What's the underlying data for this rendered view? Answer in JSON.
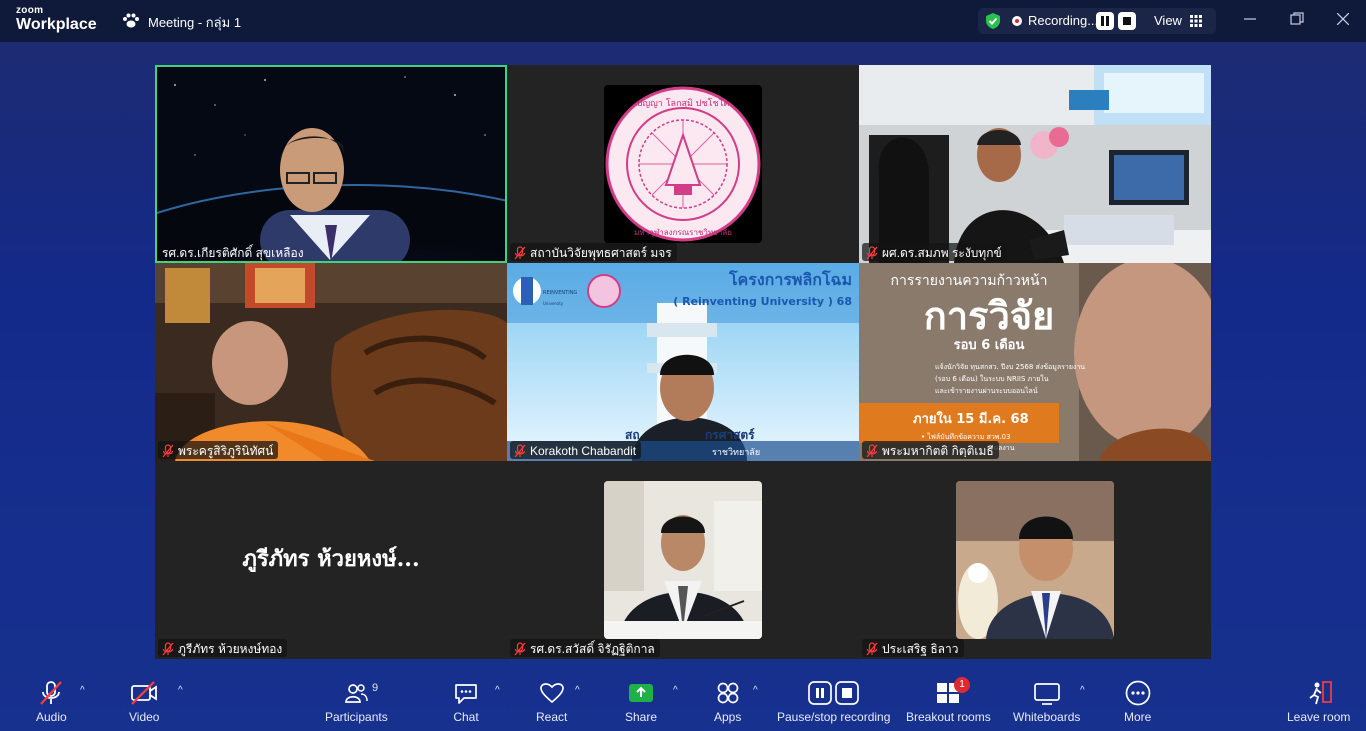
{
  "app": {
    "logo_line1": "zoom",
    "logo_line2": "Workplace",
    "meeting_title": "Meeting - กลุ่ม 1"
  },
  "recording": {
    "status": "Recording...",
    "view_label": "View"
  },
  "participants": [
    {
      "name": "รศ.ดร.เกียรติศักดิ์ สุขเหลือง",
      "muted": false,
      "active": true
    },
    {
      "name": "สถาบันวิจัยพุทธศาสตร์ มจร",
      "muted": true
    },
    {
      "name": "ผศ.ดร.สมภพ  ระงับทุกข์",
      "muted": true
    },
    {
      "name": "พระครูสิริภูรินิทัศน์",
      "muted": true
    },
    {
      "name": "Korakoth Chabandit",
      "muted": true
    },
    {
      "name": "พระมหากิตติ กิตฺติเมธี",
      "muted": true
    },
    {
      "name": "ภูรีภัทร ห้วยหงษ์ทอง",
      "muted": true,
      "display_name": "ภูรีภัทร ห้วยหงษ์..."
    },
    {
      "name": "รศ.ดร.สวัสดิ์ จิรัฏฐิติกาล",
      "muted": true
    },
    {
      "name": "ประเสริฐ ธิลาว",
      "muted": true
    }
  ],
  "seal": {
    "top_text": "ปญญา  โลกสฺมิ  ปชโชโต",
    "ring_text": "มหาจุฬาลงกรณราชวิทยาลัย"
  },
  "slides": {
    "reinventing_title": "โครงการพลิกโฉม",
    "reinventing_sub": "( Reinventing University ) 68",
    "reinventing_logo": "REINVENTING",
    "reinventing_logo_sub": "University",
    "reinventing_bottom": "สถ",
    "reinventing_bottom2": "กรศาสตร์",
    "reinventing_bottom3": "ราชวิทยาลัย",
    "research_top": "การรายงานความก้าวหน้า",
    "research_big": "การวิจัย",
    "research_round": "รอบ 6 เดือน",
    "research_note1": "แจ้งนักวิจัย ทุนสกสว. ปีงบ 2568 ส่งข้อมูลรายงาน",
    "research_note2": "(รอบ 6 เดือน) ในระบบ NRIIS ภายใน",
    "research_note3": "และเข้ารายงานผ่านระบบออนไลน์",
    "research_deadline": "ภายใน 15 มี.ค. 68",
    "research_note4": "• ไฟล์บันทึกข้อความ สวพ.03",
    "research_note5": "ผลงาน"
  },
  "toolbar": {
    "audio": "Audio",
    "video": "Video",
    "participants": "Participants",
    "participants_count": "9",
    "chat": "Chat",
    "react": "React",
    "share": "Share",
    "apps": "Apps",
    "pause_stop": "Pause/stop recording",
    "breakout": "Breakout rooms",
    "breakout_badge": "1",
    "whiteboards": "Whiteboards",
    "more": "More",
    "leave": "Leave room"
  }
}
